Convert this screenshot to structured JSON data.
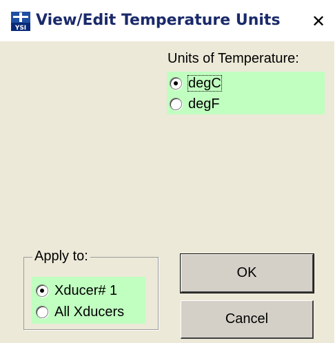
{
  "window": {
    "title": "View/Edit Temperature Units",
    "app_icon_text": "YSI",
    "close_symbol": "✕"
  },
  "units": {
    "label": "Units of Temperature:",
    "options": [
      {
        "label": "degC",
        "checked": true
      },
      {
        "label": "degF",
        "checked": false
      }
    ],
    "highlight_color": "#c0ffc0"
  },
  "apply_to": {
    "label": "Apply to:",
    "options": [
      {
        "label": "Xducer# 1",
        "checked": true
      },
      {
        "label": "All Xducers",
        "checked": false
      }
    ]
  },
  "buttons": {
    "ok_label": "OK",
    "cancel_label": "Cancel"
  }
}
